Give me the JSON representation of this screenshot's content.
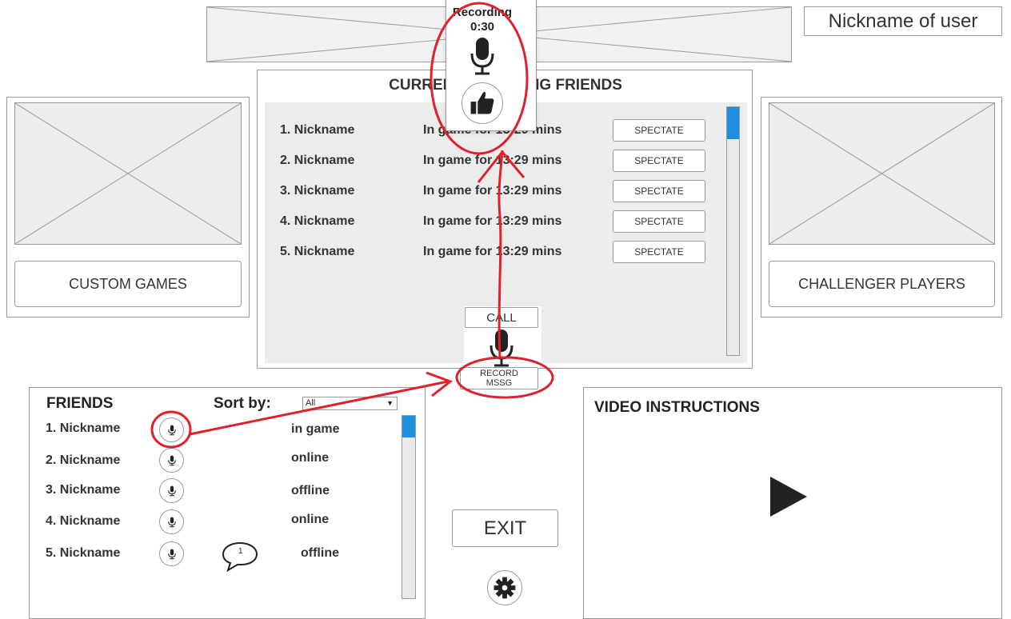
{
  "header": {
    "nickname_label": "Nickname of user"
  },
  "recording_popup": {
    "title": "Recording",
    "time": "0:30",
    "mic_icon": "microphone-icon",
    "like_icon": "thumbs-up-icon"
  },
  "current_friends": {
    "title": "CURRENTLY PLAYING FRIENDS",
    "rows": [
      {
        "name": "1. Nickname",
        "status": "In game for 13:29 mins",
        "action": "SPECTATE"
      },
      {
        "name": "2. Nickname",
        "status": "In game for 13:29 mins",
        "action": "SPECTATE"
      },
      {
        "name": "3. Nickname",
        "status": "In game for 13:29 mins",
        "action": "SPECTATE"
      },
      {
        "name": "4. Nickname",
        "status": "In game for 13:29 mins",
        "action": "SPECTATE"
      },
      {
        "name": "5. Nickname",
        "status": "In game for 13:29 mins",
        "action": "SPECTATE"
      }
    ],
    "call_label": "CALL",
    "record_label_line1": "RECORD",
    "record_label_line2": "MSSG"
  },
  "left_panel": {
    "button_label": "CUSTOM GAMES"
  },
  "right_panel": {
    "button_label": "CHALLENGER PLAYERS"
  },
  "friends": {
    "title": "FRIENDS",
    "sort_label": "Sort by:",
    "sort_selected": "All",
    "rows": [
      {
        "name": "1. Nickname",
        "status": "in game"
      },
      {
        "name": "2. Nickname",
        "status": "online"
      },
      {
        "name": "3. Nickname",
        "status": "offline"
      },
      {
        "name": "4. Nickname",
        "status": "online"
      },
      {
        "name": "5. Nickname",
        "status": "offline"
      }
    ],
    "message_badge_count": "1"
  },
  "center": {
    "exit_label": "EXIT",
    "settings_icon": "gear-icon"
  },
  "video": {
    "title": "VIDEO INSTRUCTIONS",
    "play_icon": "play-icon"
  },
  "colors": {
    "accent_blue": "#1c8fe0",
    "annotation_red": "#e0202a",
    "border_gray": "#9a9a9a",
    "panel_gray": "#ececec"
  }
}
